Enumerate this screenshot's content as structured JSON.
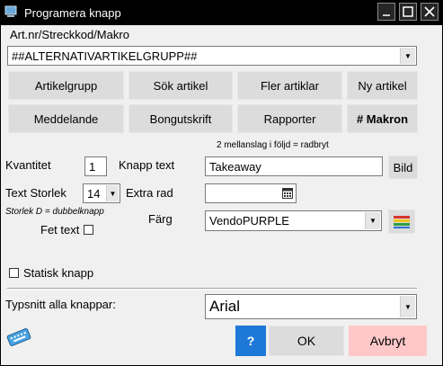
{
  "window": {
    "title": "Programera knapp"
  },
  "article": {
    "label": "Art.nr/Streckkod/Makro",
    "value": "##ALTERNATIVARTIKELGRUPP##"
  },
  "buttons_row1": [
    "Artikelgrupp",
    "Sök artikel",
    "Fler artiklar",
    "Ny artikel"
  ],
  "buttons_row2": [
    "Meddelande",
    "Bongutskrift",
    "Rapporter",
    "# Makron"
  ],
  "hint": "2 mellanslag i följd = radbryt",
  "quantity": {
    "label": "Kvantitet",
    "value": "1"
  },
  "button_text": {
    "label": "Knapp text",
    "value": "Takeaway",
    "image_button": "Bild"
  },
  "text_size": {
    "label": "Text Storlek",
    "value": "14",
    "note": "Storlek D = dubbelknapp"
  },
  "extra_row": {
    "label": "Extra rad",
    "value": ""
  },
  "bold_text": {
    "label": "Fet text",
    "checked": false
  },
  "color": {
    "label": "Färg",
    "value": "VendoPURPLE"
  },
  "static_button": {
    "label": "Statisk knapp",
    "checked": false
  },
  "font": {
    "label": "Typsnitt alla knappar:",
    "value": "Arial"
  },
  "actions": {
    "help": "?",
    "ok": "OK",
    "cancel": "Avbryt"
  },
  "colors": {
    "help_bg": "#1e78d7",
    "cancel_bg": "#ffc8c8",
    "titlebar": "#000000",
    "client": "#f0f0f0"
  }
}
